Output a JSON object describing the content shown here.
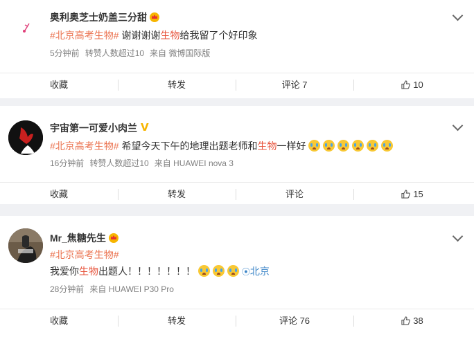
{
  "posts": [
    {
      "username": "奥利奥芝士奶盖三分甜",
      "topic": "北京高考生物",
      "text_before": "谢谢谢谢",
      "text_hl": "生物",
      "text_after": "给我留了个好印象",
      "time": "5分钟前",
      "likes_note": "转赞人数超过10",
      "source": "来自 微博国际版",
      "actions": {
        "favorite": "收藏",
        "repost": "转发",
        "comment": "评论 7",
        "like": "10"
      }
    },
    {
      "username": "宇宙第一可爱小肉兰",
      "topic": "北京高考生物",
      "text_before": "希望今天下午的地理出题老师和",
      "text_hl": "生物",
      "text_after": "一样好",
      "time": "16分钟前",
      "likes_note": "转赞人数超过10",
      "source": "来自 HUAWEI nova 3",
      "actions": {
        "favorite": "收藏",
        "repost": "转发",
        "comment": "评论",
        "like": "15"
      }
    },
    {
      "username": "Mr_焦糖先生",
      "topic": "北京高考生物",
      "text_before": "我爱你",
      "text_hl": "生物",
      "text_after": "出题人！！！！！！！",
      "location": "北京",
      "time": "28分钟前",
      "source": "来自 HUAWEI P30 Pro",
      "actions": {
        "favorite": "收藏",
        "repost": "转发",
        "comment": "评论 76",
        "like": "38"
      }
    }
  ],
  "colors": {
    "topic": "#eb7350",
    "link": "#3d86c8",
    "meta": "#808080",
    "background": "#f0f1f4"
  }
}
